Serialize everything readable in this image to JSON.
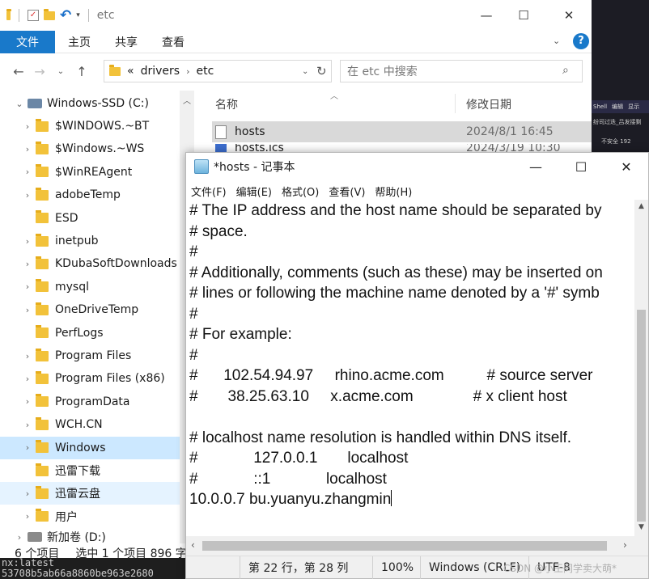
{
  "explorer": {
    "title": "etc",
    "ribbon": {
      "file": "文件",
      "tabs": [
        "主页",
        "共享",
        "查看"
      ]
    },
    "address": {
      "prefix": "«",
      "path": [
        "drivers",
        "etc"
      ]
    },
    "search_placeholder": "在 etc 中搜索",
    "columns": {
      "name": "名称",
      "modified": "修改日期"
    },
    "files": [
      {
        "name": "hosts",
        "date": "2024/8/1 16:45"
      },
      {
        "name": "hosts.ics",
        "date": "2024/3/19 10:30"
      }
    ],
    "drive": "Windows-SSD (C:)",
    "tree": [
      "$WINDOWS.~BT",
      "$Windows.~WS",
      "$WinREAgent",
      "adobeTemp",
      "ESD",
      "inetpub",
      "KDubaSoftDownloads",
      "mysql",
      "OneDriveTemp",
      "PerfLogs",
      "Program Files",
      "Program Files (x86)",
      "ProgramData",
      "WCH.CN",
      "Windows",
      "迅雷下载",
      "迅雷云盘",
      "用户"
    ],
    "next_drive": "新加卷 (D:)",
    "status": {
      "count": "6 个项目",
      "selected": "选中 1 个项目 896 字"
    }
  },
  "terminal": {
    "lines": [
      "nx:latest",
      "53708b5ab66a8860be963e2680"
    ]
  },
  "side_app": {
    "menu": [
      "Shell",
      "编辑",
      "显示"
    ],
    "line1": "纷司过迭_吕发接剩",
    "line2": "不安全  192"
  },
  "notepad": {
    "title": "*hosts - 记事本",
    "menu": [
      "文件(F)",
      "编辑(E)",
      "格式(O)",
      "查看(V)",
      "帮助(H)"
    ],
    "lines": [
      "# The IP address and the host name should be separated by",
      "# space.",
      "#",
      "# Additionally, comments (such as these) may be inserted on",
      "# lines or following the machine name denoted by a '#' symb",
      "#",
      "# For example:",
      "#",
      "#      102.54.94.97     rhino.acme.com          # source server",
      "#       38.25.63.10     x.acme.com              # x client host",
      "",
      "# localhost name resolution is handled within DNS itself.",
      "#             127.0.0.1       localhost",
      "#             ::1             localhost",
      "10.0.0.7 bu.yuanyu.zhangmin"
    ],
    "status": {
      "position": "第 22 行，第 28 列",
      "zoom": "100%",
      "eol": "Windows (CRLF)",
      "encoding": "UTF-8"
    },
    "watermark": "CSDN @小王同学卖大萌*"
  }
}
